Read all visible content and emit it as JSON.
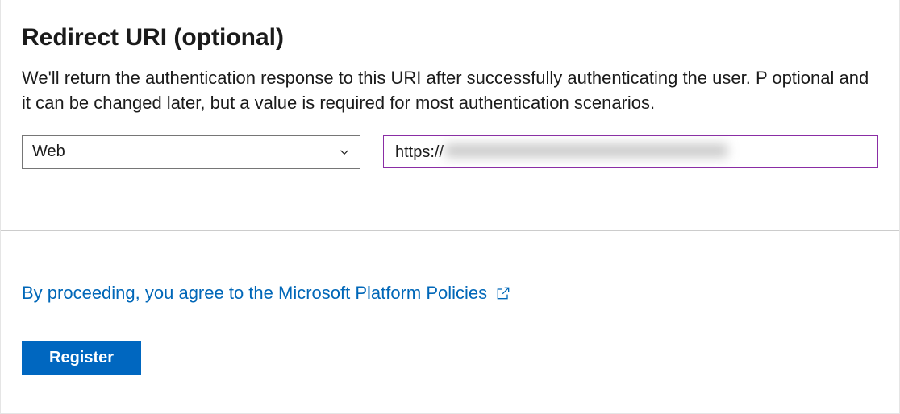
{
  "heading": "Redirect URI (optional)",
  "description": "We'll return the authentication response to this URI after successfully authenticating the user. P optional and it can be changed later, but a value is required for most authentication scenarios.",
  "platformSelect": {
    "value": "Web"
  },
  "uriInput": {
    "prefix": "https://"
  },
  "policiesLink": {
    "text": "By proceeding, you agree to the Microsoft Platform Policies"
  },
  "registerButton": {
    "label": "Register"
  },
  "colors": {
    "primary": "#0067c0",
    "link": "#0067b8",
    "inputFocusBorder": "#8a2da5"
  }
}
